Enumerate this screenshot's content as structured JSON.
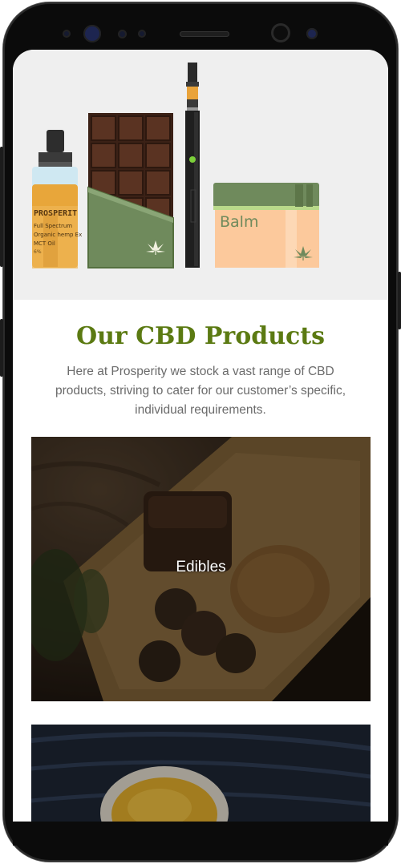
{
  "hero": {
    "bottle_brand": "PROSPERIT",
    "bottle_lines": [
      "Full Spectrum",
      "Organic hemp Ex",
      "MCT Oil",
      "6%"
    ],
    "jar_label": "Balm"
  },
  "section": {
    "title": "Our CBD Products",
    "intro": "Here at Prosperity we stock a vast range of CBD products, striving to cater for our customer’s specific, individual requirements."
  },
  "categories": [
    {
      "label": "Edibles"
    },
    {
      "label": ""
    }
  ],
  "colors": {
    "title": "#5b7a12",
    "hero_bg": "#efefef",
    "oil_amber": "#e8a63a",
    "chocolate": "#4a2a1c",
    "wrapper_green": "#6f8a5c",
    "balm_peach": "#fcc99c"
  }
}
